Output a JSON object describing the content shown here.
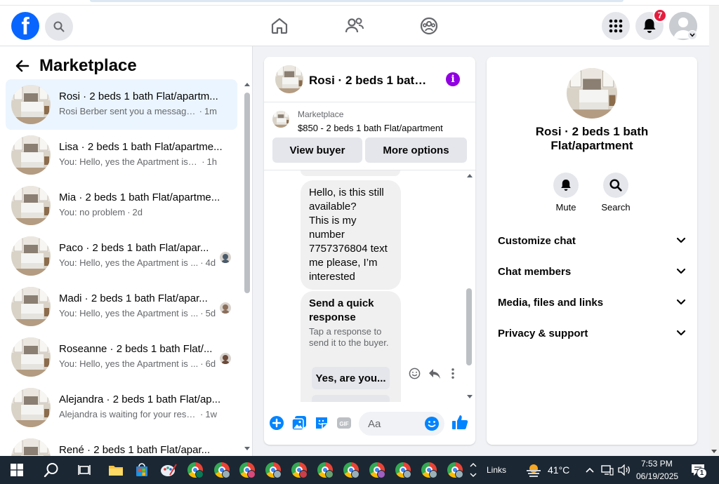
{
  "header": {
    "logo_letter": "f",
    "notification_count": "7"
  },
  "left": {
    "title": "Marketplace",
    "conversations": [
      {
        "title": "Rosi · 2 beds 1 bath Flat/apartm...",
        "snippet": "Rosi Berber sent you a message ab...",
        "sep": "·",
        "time": "1m",
        "active": true
      },
      {
        "title": "Lisa · 2 beds 1 bath Flat/apartme...",
        "snippet": "You: Hello, yes the Apartment is stil...",
        "sep": "·",
        "time": "1h"
      },
      {
        "title": "Mia · 2 beds 1 bath Flat/apartme...",
        "snippet": "You: no problem",
        "sep": "·",
        "time": "2d"
      },
      {
        "title": "Paco · 2 beds 1 bath Flat/apar...",
        "snippet": "You: Hello, yes the Apartment is ...",
        "sep": "·",
        "time": "4d",
        "read": true
      },
      {
        "title": "Madi · 2 beds 1 bath Flat/apar...",
        "snippet": "You: Hello, yes the Apartment is ...",
        "sep": "·",
        "time": "5d",
        "read": true
      },
      {
        "title": "Roseanne · 2 beds 1 bath Flat/...",
        "snippet": "You: Hello, yes the Apartment is ...",
        "sep": "·",
        "time": "6d",
        "read": true
      },
      {
        "title": "Alejandra · 2 beds 1 bath Flat/ap...",
        "snippet": "Alejandra is waiting for your respo...",
        "sep": "·",
        "time": "1w"
      },
      {
        "title": "René · 2 beds 1 bath Flat/apar...",
        "snippet": "",
        "sep": "",
        "time": ""
      }
    ]
  },
  "chat": {
    "title": "Rosi · 2 beds 1 bath F...",
    "info_glyph": "i",
    "listing_label": "Marketplace",
    "listing_price": "$850 - 2 beds 1 bath Flat/apartment",
    "view_buyer": "View buyer",
    "more_options": "More options",
    "message_lines": [
      "Hello, is this still",
      "available?",
      "This is my",
      "number",
      "7757376804 text",
      "me please, I’m",
      "interested"
    ],
    "quick_title": "Send a quick response",
    "quick_sub": "Tap a response to send it to the buyer.",
    "quick_option": "Yes, are you...",
    "input_placeholder": "Aa"
  },
  "info": {
    "title": "Rosi · 2 beds 1 bath Flat/apartment",
    "mute_label": "Mute",
    "search_label": "Search",
    "sections": [
      "Customize chat",
      "Chat members",
      "Media, files and links",
      "Privacy & support"
    ]
  },
  "taskbar": {
    "links_label": "Links",
    "temperature": "41°C",
    "time": "7:53 PM",
    "date": "06/19/2025",
    "notif_count": "1"
  },
  "colors": {
    "brand_blue": "#0866ff",
    "messenger_blue": "#0084ff",
    "info_purple": "#9000e0",
    "badge_red": "#e41e3f",
    "active_row": "#ebf5ff"
  }
}
